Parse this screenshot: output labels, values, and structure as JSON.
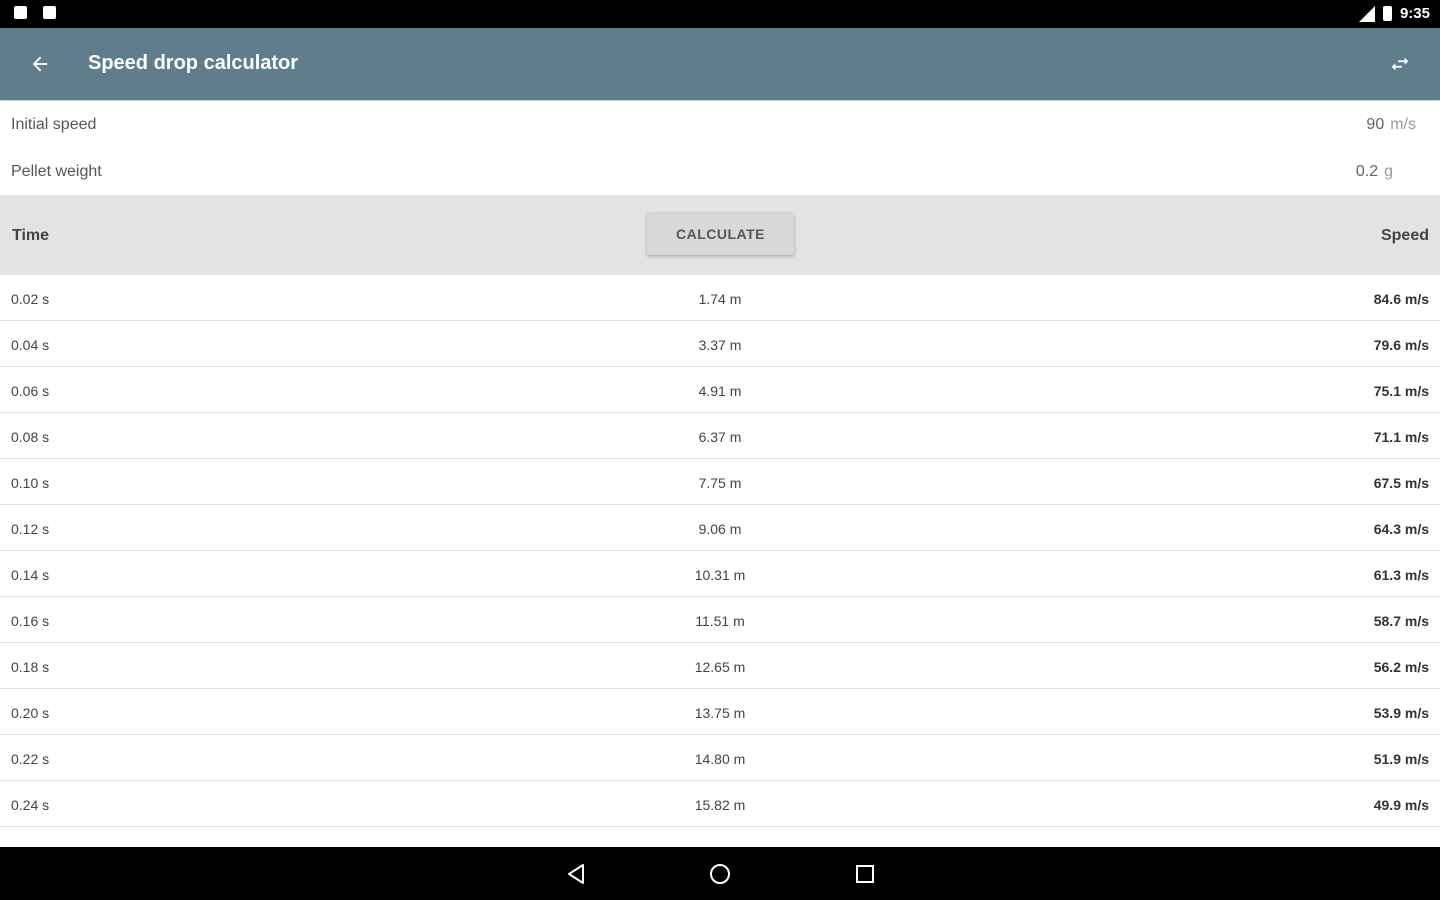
{
  "status_bar": {
    "time": "9:35"
  },
  "app_bar": {
    "title": "Speed drop calculator"
  },
  "inputs": {
    "initial_speed": {
      "label": "Initial speed",
      "value": "90",
      "unit": "m/s"
    },
    "pellet_weight": {
      "label": "Pellet weight",
      "value": "0.2",
      "unit": "g"
    }
  },
  "table": {
    "header_time": "Time",
    "calculate_label": "CALCULATE",
    "header_speed": "Speed",
    "rows": [
      {
        "time": "0.02 s",
        "drop": "1.74 m",
        "speed": "84.6 m/s"
      },
      {
        "time": "0.04 s",
        "drop": "3.37 m",
        "speed": "79.6 m/s"
      },
      {
        "time": "0.06 s",
        "drop": "4.91 m",
        "speed": "75.1 m/s"
      },
      {
        "time": "0.08 s",
        "drop": "6.37 m",
        "speed": "71.1 m/s"
      },
      {
        "time": "0.10 s",
        "drop": "7.75 m",
        "speed": "67.5 m/s"
      },
      {
        "time": "0.12 s",
        "drop": "9.06 m",
        "speed": "64.3 m/s"
      },
      {
        "time": "0.14 s",
        "drop": "10.31 m",
        "speed": "61.3 m/s"
      },
      {
        "time": "0.16 s",
        "drop": "11.51 m",
        "speed": "58.7 m/s"
      },
      {
        "time": "0.18 s",
        "drop": "12.65 m",
        "speed": "56.2 m/s"
      },
      {
        "time": "0.20 s",
        "drop": "13.75 m",
        "speed": "53.9 m/s"
      },
      {
        "time": "0.22 s",
        "drop": "14.80 m",
        "speed": "51.9 m/s"
      },
      {
        "time": "0.24 s",
        "drop": "15.82 m",
        "speed": "49.9 m/s"
      }
    ]
  },
  "icons": {
    "back": "arrow-back-icon",
    "swap": "swap-horiz-icon",
    "nav_back": "triangle-back-icon",
    "nav_home": "circle-home-icon",
    "nav_recents": "square-recents-icon"
  },
  "colors": {
    "app_bar": "#607d8b",
    "header_bg": "#e3e3e3"
  }
}
